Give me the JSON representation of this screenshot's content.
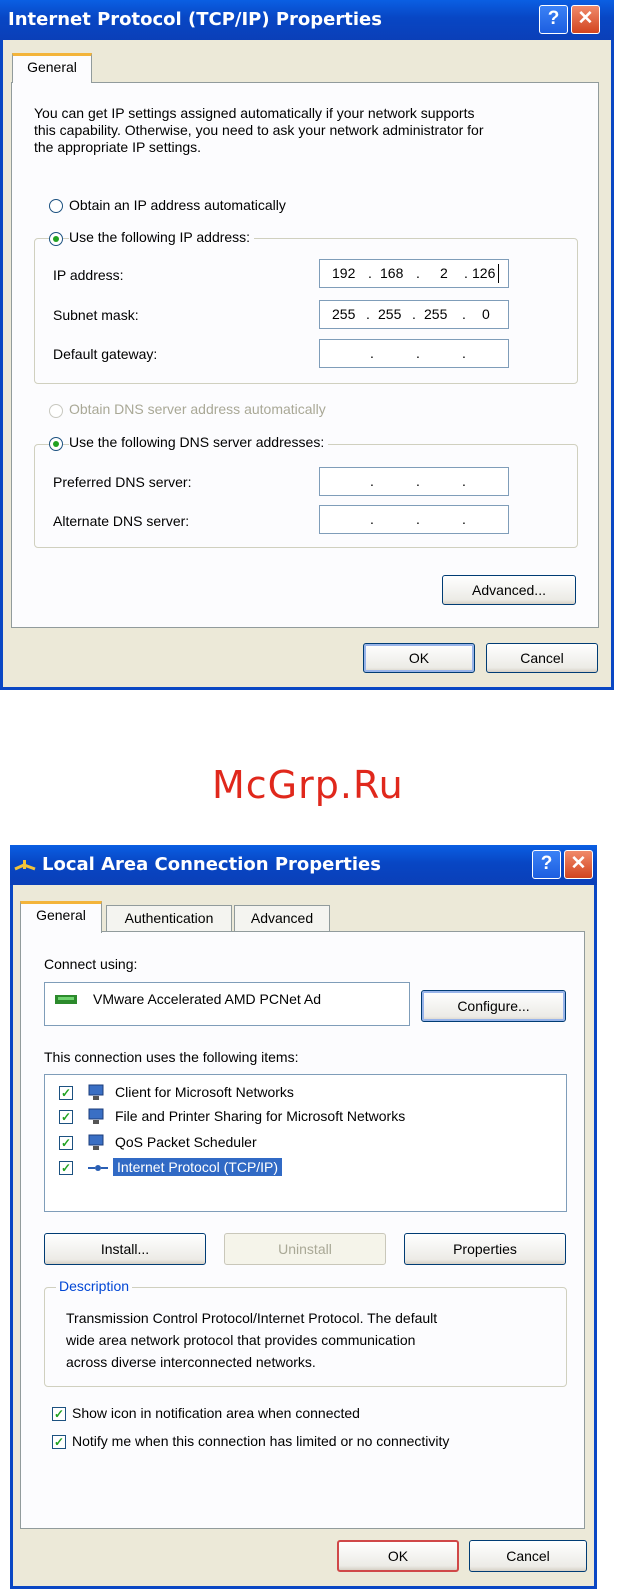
{
  "watermark": "McGrp.Ru",
  "tcpip": {
    "title": "Internet Protocol (TCP/IP) Properties",
    "help_glyph": "?",
    "close_glyph": "✕",
    "tab_general": "General",
    "intro_lines": [
      "You can get IP settings assigned automatically if your network supports",
      "this capability. Otherwise, you need to ask your network administrator for",
      "the appropriate IP settings."
    ],
    "radio_auto_ip": "Obtain an IP address automatically",
    "radio_manual_ip": "Use the following IP address:",
    "ip_label": "IP address:",
    "ip_value": [
      "192",
      "168",
      "2",
      "126"
    ],
    "subnet_label": "Subnet mask:",
    "subnet_value": [
      "255",
      "255",
      "255",
      "0"
    ],
    "gateway_label": "Default gateway:",
    "radio_auto_dns": "Obtain DNS server address automatically",
    "radio_manual_dns": "Use the following DNS server addresses:",
    "pref_dns_label": "Preferred DNS server:",
    "alt_dns_label": "Alternate DNS server:",
    "dot": ".",
    "advanced_label": "Advanced...",
    "ok_label": "OK",
    "cancel_label": "Cancel"
  },
  "lan": {
    "title": "Local Area Connection Properties",
    "help_glyph": "?",
    "close_glyph": "✕",
    "tabs": [
      "General",
      "Authentication",
      "Advanced"
    ],
    "connect_using_label": "Connect using:",
    "adapter_name": "VMware Accelerated AMD PCNet Ad",
    "configure_label": "Configure...",
    "items_label": "This connection uses the following items:",
    "items": [
      {
        "label": "Client for Microsoft Networks",
        "checked": true
      },
      {
        "label": "File and Printer Sharing for Microsoft Networks",
        "checked": true
      },
      {
        "label": "QoS Packet Scheduler",
        "checked": true
      },
      {
        "label": "Internet Protocol (TCP/IP)",
        "checked": true
      }
    ],
    "check_glyph": "✓",
    "install_label": "Install...",
    "uninstall_label": "Uninstall",
    "properties_label": "Properties",
    "description_label": "Description",
    "description_lines": [
      "Transmission Control Protocol/Internet Protocol. The default",
      "wide area network protocol that provides communication",
      "across diverse interconnected networks."
    ],
    "show_icon_label": "Show icon in notification area when connected",
    "notify_label": "Notify me when this connection has limited or no connectivity",
    "ok_label": "OK",
    "cancel_label": "Cancel"
  },
  "colors": {
    "title_blue": "#0846c4",
    "accent_red": "#e0281c",
    "selection": "#316ac5",
    "dialog_bg": "#ece9d8"
  }
}
